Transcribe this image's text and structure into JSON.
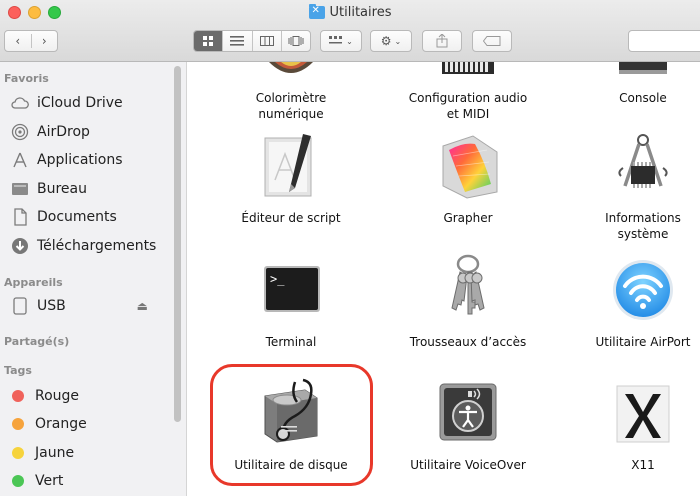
{
  "window": {
    "title": "Utilitaires"
  },
  "toolbar": {
    "back": "‹",
    "forward": "›",
    "views": [
      "icon-view",
      "list-view",
      "column-view",
      "cover-flow-view"
    ],
    "arrange_icon": "group-icon",
    "action_icon": "gear-icon",
    "share_icon": "share-icon",
    "tag_icon": "tag-icon"
  },
  "sidebar": {
    "favorites": {
      "header": "Favoris",
      "items": [
        {
          "label": "iCloud Drive",
          "icon": "cloud-icon"
        },
        {
          "label": "AirDrop",
          "icon": "airdrop-icon"
        },
        {
          "label": "Applications",
          "icon": "applications-icon"
        },
        {
          "label": "Bureau",
          "icon": "desktop-icon"
        },
        {
          "label": "Documents",
          "icon": "document-icon"
        },
        {
          "label": "Téléchargements",
          "icon": "download-icon"
        }
      ]
    },
    "devices": {
      "header": "Appareils",
      "items": [
        {
          "label": "USB",
          "icon": "drive-icon",
          "eject": "⏏"
        }
      ]
    },
    "shared": {
      "header": "Partagé(s)"
    },
    "tags": {
      "header": "Tags",
      "items": [
        {
          "label": "Rouge",
          "color": "#f0625b"
        },
        {
          "label": "Orange",
          "color": "#f6a33c"
        },
        {
          "label": "Jaune",
          "color": "#f6d33c"
        },
        {
          "label": "Vert",
          "color": "#4bc655"
        }
      ]
    }
  },
  "grid": {
    "items": [
      {
        "label": "Colorimètre\nnumérique",
        "icon": "colorimeter-icon"
      },
      {
        "label": "Configuration audio\net MIDI",
        "icon": "audio-midi-icon"
      },
      {
        "label": "Console",
        "icon": "console-icon"
      },
      {
        "label": "Éditeur de script",
        "icon": "script-editor-icon"
      },
      {
        "label": "Grapher",
        "icon": "grapher-icon"
      },
      {
        "label": "Informations\nsystème",
        "icon": "system-information-icon"
      },
      {
        "label": "Terminal",
        "icon": "terminal-icon"
      },
      {
        "label": "Trousseaux d’accès",
        "icon": "keychain-icon"
      },
      {
        "label": "Utilitaire AirPort",
        "icon": "airport-icon"
      },
      {
        "label": "Utilitaire de disque",
        "icon": "disk-utility-icon",
        "highlighted": true
      },
      {
        "label": "Utilitaire VoiceOver",
        "icon": "voiceover-icon"
      },
      {
        "label": "X11",
        "icon": "x11-icon"
      }
    ]
  }
}
